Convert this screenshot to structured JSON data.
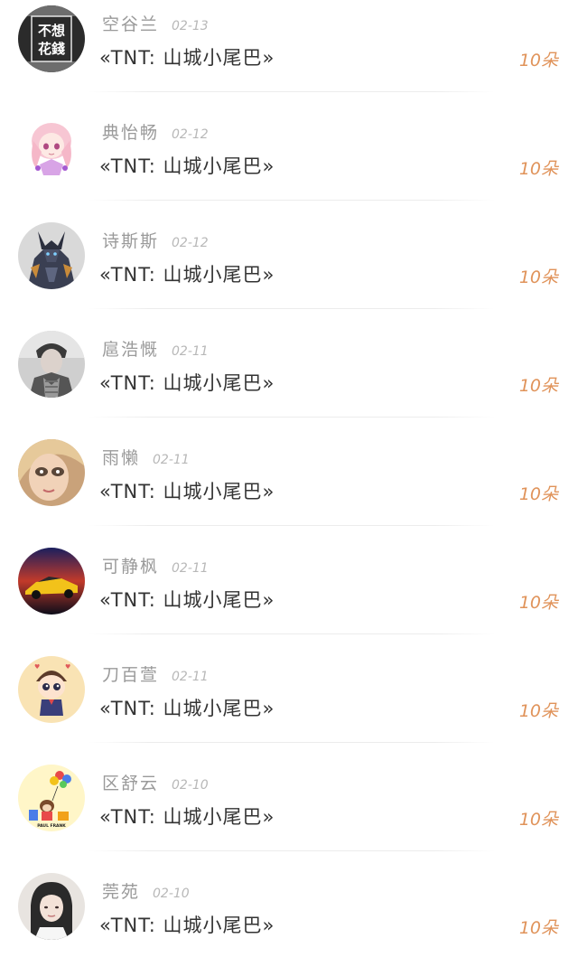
{
  "entries": [
    {
      "name": "空谷兰",
      "date": "02-13",
      "gift": "«TNT: 山城小尾巴»",
      "amount": "10朵",
      "avatar": "calligraphy-avatar"
    },
    {
      "name": "典怡畅",
      "date": "02-12",
      "gift": "«TNT: 山城小尾巴»",
      "amount": "10朵",
      "avatar": "anime-girl-avatar"
    },
    {
      "name": "诗斯斯",
      "date": "02-12",
      "gift": "«TNT: 山城小尾巴»",
      "amount": "10朵",
      "avatar": "armored-warrior-avatar"
    },
    {
      "name": "扈浩慨",
      "date": "02-11",
      "gift": "«TNT: 山城小尾巴»",
      "amount": "10朵",
      "avatar": "man-photo-avatar"
    },
    {
      "name": "雨懒",
      "date": "02-11",
      "gift": "«TNT: 山城小尾巴»",
      "amount": "10朵",
      "avatar": "doll-face-avatar"
    },
    {
      "name": "可静枫",
      "date": "02-11",
      "gift": "«TNT: 山城小尾巴»",
      "amount": "10朵",
      "avatar": "sports-car-avatar"
    },
    {
      "name": "刀百萱",
      "date": "02-11",
      "gift": "«TNT: 山城小尾巴»",
      "amount": "10朵",
      "avatar": "cartoon-boy-avatar"
    },
    {
      "name": "区舒云",
      "date": "02-10",
      "gift": "«TNT: 山城小尾巴»",
      "amount": "10朵",
      "avatar": "paul-frank-monkey-avatar"
    },
    {
      "name": "莞苑",
      "date": "02-10",
      "gift": "«TNT: 山城小尾巴»",
      "amount": "10朵",
      "avatar": "girl-photo-avatar"
    }
  ],
  "avatar_texts": {
    "calligraphy": [
      "不想",
      "花錢"
    ],
    "paul_frank": "PAUL FRANK"
  },
  "colors": {
    "name": "#9a9a9a",
    "date": "#b8b8b8",
    "gift": "#333333",
    "amount": "#e0935a",
    "divider": "#ececec"
  }
}
